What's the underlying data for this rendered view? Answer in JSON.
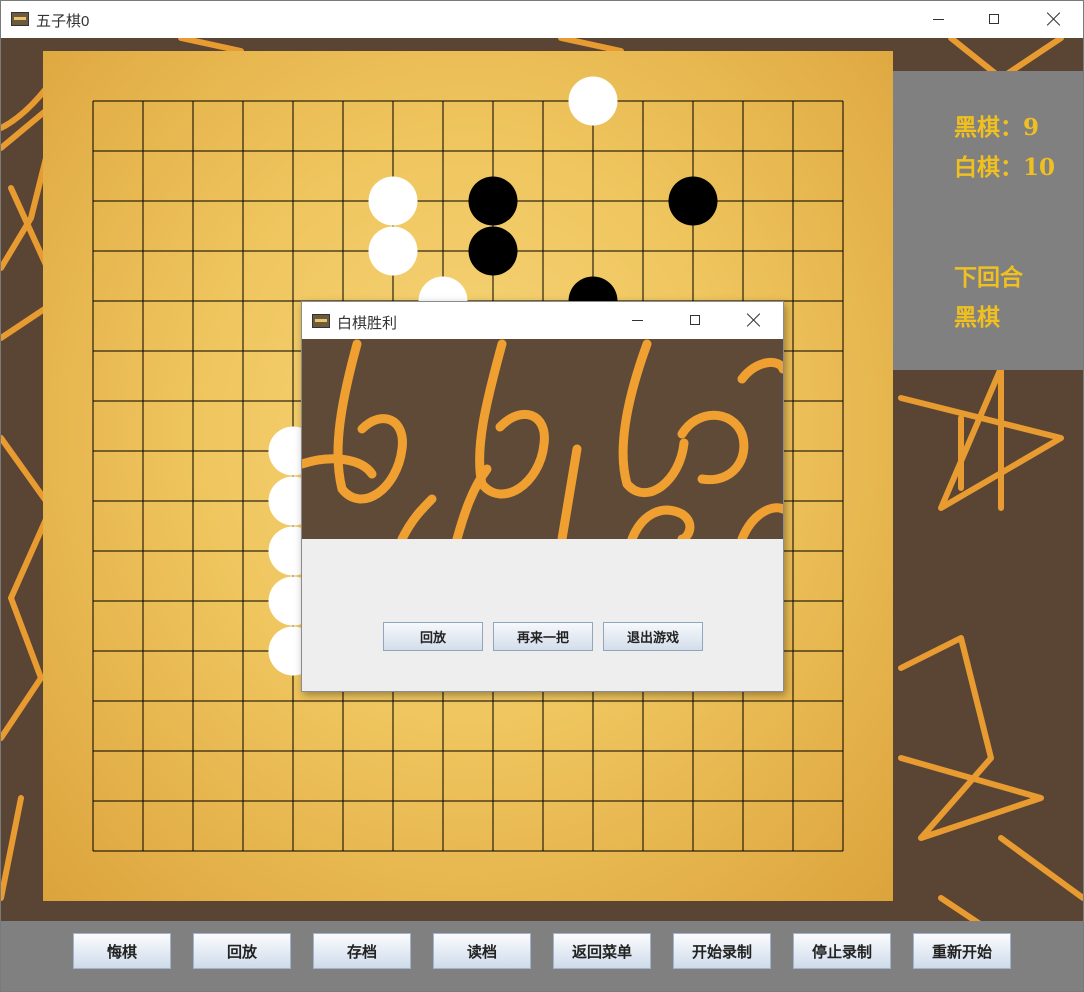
{
  "window": {
    "title": "五子棋0"
  },
  "info": {
    "black_label": "黑棋：",
    "black_count": "9",
    "white_label": "白棋：",
    "white_count": "10",
    "next_turn_label": "下回合",
    "next_turn_player": "黑棋"
  },
  "board": {
    "size": 16,
    "stones": [
      {
        "color": "white",
        "col": 10,
        "row": 0
      },
      {
        "color": "white",
        "col": 6,
        "row": 2
      },
      {
        "color": "black",
        "col": 8,
        "row": 2
      },
      {
        "color": "black",
        "col": 12,
        "row": 2
      },
      {
        "color": "white",
        "col": 6,
        "row": 3
      },
      {
        "color": "black",
        "col": 8,
        "row": 3
      },
      {
        "color": "white",
        "col": 7,
        "row": 4
      },
      {
        "color": "black",
        "col": 10,
        "row": 4
      },
      {
        "color": "white",
        "col": 4,
        "row": 7
      },
      {
        "color": "white",
        "col": 4,
        "row": 8
      },
      {
        "color": "white",
        "col": 4,
        "row": 9
      },
      {
        "color": "white",
        "col": 4,
        "row": 10
      },
      {
        "color": "white",
        "col": 4,
        "row": 11
      }
    ]
  },
  "toolbar": {
    "buttons": [
      "悔棋",
      "回放",
      "存档",
      "读档",
      "返回菜单",
      "开始录制",
      "停止录制",
      "重新开始"
    ]
  },
  "dialog": {
    "title": "白棋胜利",
    "buttons": [
      "回放",
      "再来一把",
      "退出游戏"
    ]
  },
  "colors": {
    "board_accent": "#efc55e",
    "panel_text": "#f0c020",
    "panel_bg": "#808080",
    "doodle": "#f0a030"
  }
}
